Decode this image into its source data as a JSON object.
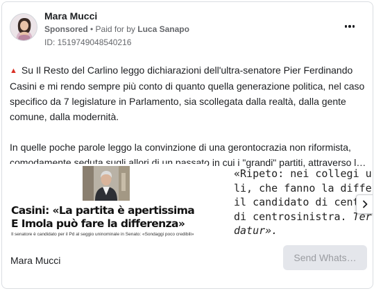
{
  "ad": {
    "advertiser_name": "Mara Mucci",
    "sponsored_label": "Sponsored",
    "separator": " • ",
    "paid_for_prefix": "Paid for by ",
    "payer": "Luca Sanapo",
    "library_id": "ID: 1519749048540216"
  },
  "body": {
    "warning_icon": "red-triangle-icon",
    "paragraph1": "Su Il Resto del Carlino leggo dichiarazioni dell'ultra-senatore Pier Ferdinando Casini e mi rendo sempre più conto di quanto quella generazione politica, nel caso specifico da 7 legislature in Parlamento, sia scollegata dalla realtà, dalla gente comune, dalla modernità.",
    "paragraph2_line1": "In quelle poche parole leggo la convinzione di una gerontocrazia non riformista,",
    "paragraph2_line2": "comodamente seduta sugli allori di un passato in cui i \"grandi\" partiti, attraverso l…"
  },
  "carousel": {
    "slide1": {
      "headline_line1": "Casini: «La partita è apertissima",
      "headline_line2": "E Imola può fare la differenza»",
      "subline": "Il senatore è candidato per il Pd al seggio uninominale in Senato: «Sondaggi poco credibili»"
    },
    "slide2": {
      "line1": "«Ripeto: nei collegi uninom",
      "line2": "li, che fanno la differenza, c",
      "line3": "il candidato di centro",
      "line4_a": "di centrosinistra. ",
      "line4_b": "Tertium",
      "line5": "datur»."
    },
    "next_icon": "chevron-right-icon"
  },
  "footer": {
    "page_name": "Mara Mucci",
    "cta_label": "Send Whats…"
  },
  "colors": {
    "text": "#1c1e21",
    "secondary": "#65676b",
    "cta_bg": "#e4e6eb",
    "cta_text": "#9a9ca1",
    "triangle": "#d93025"
  }
}
